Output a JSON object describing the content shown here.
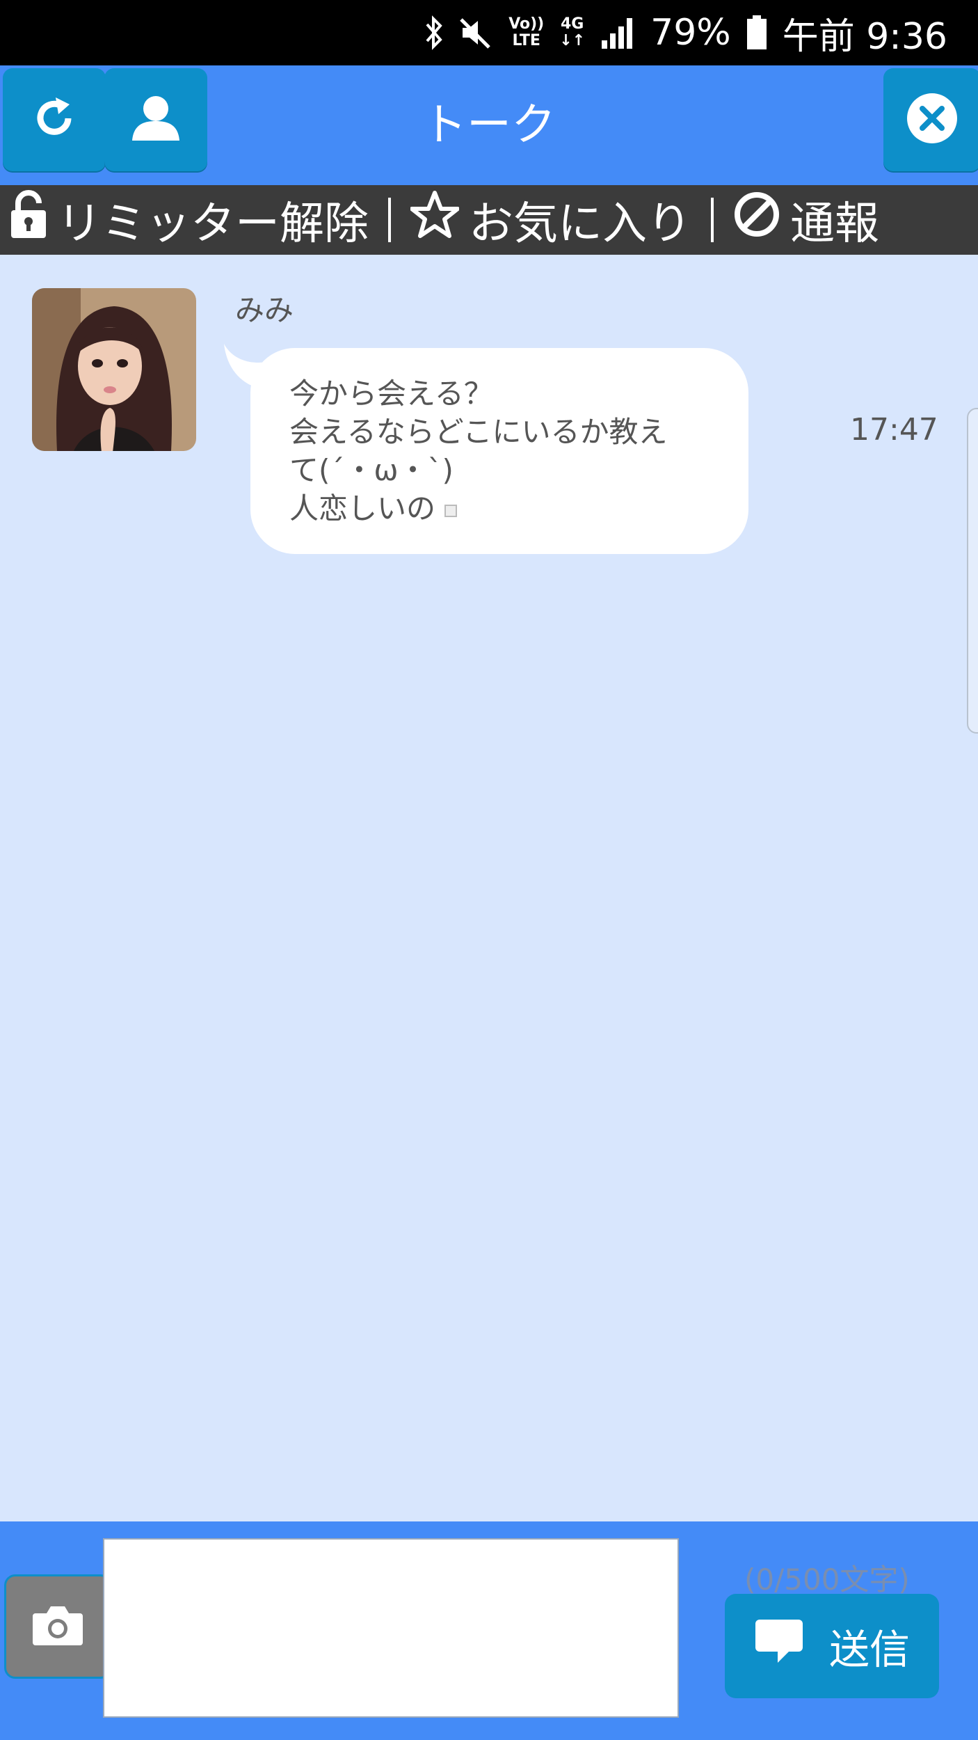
{
  "status_bar": {
    "volte_top": "Vo))",
    "volte_bottom": "LTE",
    "network_top": "4G",
    "network_bottom": "↓↑",
    "battery": "79%",
    "time": "午前 9:36"
  },
  "header": {
    "title": "トーク",
    "icons": [
      "refresh-icon",
      "profile-icon",
      "close-icon"
    ]
  },
  "action_bar": {
    "items": [
      {
        "label": "リミッター解除",
        "icon": "lock-icon"
      },
      {
        "label": "お気に入り",
        "icon": "star-icon"
      },
      {
        "label": "通報",
        "icon": "ban-icon"
      }
    ]
  },
  "messages": [
    {
      "sender": "みみ",
      "lines": [
        "今から会える？",
        "会えるならどこにいるか教え",
        "て(´・ω・`)",
        "人恋しいの"
      ],
      "time": "17:47"
    }
  ],
  "composer": {
    "value": "",
    "char_count": "(0/500文字)",
    "send_label": "送信"
  },
  "colors": {
    "header_blue": "#448bf7",
    "button_blue": "#0d8fc9",
    "chat_bg": "#d8e6fd",
    "action_bar": "#3b3b3b"
  }
}
